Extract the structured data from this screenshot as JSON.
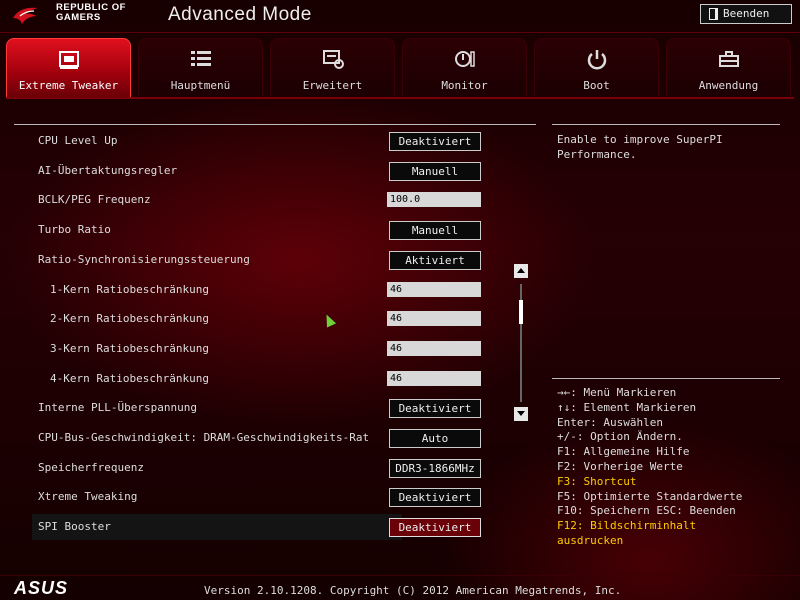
{
  "header": {
    "brand_line1": "REPUBLIC OF",
    "brand_line2": "GAMERS",
    "mode_title": "Advanced Mode",
    "exit_label": "Beenden"
  },
  "tabs": [
    {
      "label": "Extreme Tweaker",
      "icon": "tweaker-icon",
      "active": true
    },
    {
      "label": "Hauptmenü",
      "icon": "list-icon",
      "active": false
    },
    {
      "label": "Erweitert",
      "icon": "advanced-icon",
      "active": false
    },
    {
      "label": "Monitor",
      "icon": "monitor-icon",
      "active": false
    },
    {
      "label": "Boot",
      "icon": "power-icon",
      "active": false
    },
    {
      "label": "Anwendung",
      "icon": "toolbox-icon",
      "active": false
    }
  ],
  "settings": [
    {
      "label": "CPU Level Up",
      "value": "Deaktiviert",
      "type": "button"
    },
    {
      "label": "AI-Übertaktungsregler",
      "value": "Manuell",
      "type": "button"
    },
    {
      "label": "BCLK/PEG Frequenz",
      "value": "100.0",
      "type": "input"
    },
    {
      "label": "Turbo Ratio",
      "value": "Manuell",
      "type": "button"
    },
    {
      "label": "Ratio-Synchronisierungssteuerung",
      "value": "Aktiviert",
      "type": "button"
    },
    {
      "label": "1-Kern Ratiobeschränkung",
      "value": "46",
      "type": "input"
    },
    {
      "label": "2-Kern Ratiobeschränkung",
      "value": "46",
      "type": "input"
    },
    {
      "label": "3-Kern Ratiobeschränkung",
      "value": "46",
      "type": "input"
    },
    {
      "label": "4-Kern Ratiobeschränkung",
      "value": "46",
      "type": "input"
    },
    {
      "label": "Interne PLL-Überspannung",
      "value": "Deaktiviert",
      "type": "button"
    },
    {
      "label": "CPU-Bus-Geschwindigkeit: DRAM-Geschwindigkeits-Rat",
      "value": "Auto",
      "type": "button"
    },
    {
      "label": "Speicherfrequenz",
      "value": "DDR3-1866MHz",
      "type": "button"
    },
    {
      "label": "Xtreme Tweaking",
      "value": "Deaktiviert",
      "type": "button"
    },
    {
      "label": "SPI Booster",
      "value": "Deaktiviert",
      "type": "button"
    }
  ],
  "help": {
    "text": "Enable to improve SuperPI Performance."
  },
  "keys": [
    {
      "text": "→←: Menü Markieren",
      "highlight": false
    },
    {
      "text": "↑↓: Element Markieren",
      "highlight": false
    },
    {
      "text": "Enter: Auswählen",
      "highlight": false
    },
    {
      "text": "+/-: Option Ändern.",
      "highlight": false
    },
    {
      "text": "F1: Allgemeine Hilfe",
      "highlight": false
    },
    {
      "text": "F2: Vorherige Werte",
      "highlight": false
    },
    {
      "text": "F3: Shortcut",
      "highlight": true
    },
    {
      "text": "F5: Optimierte Standardwerte",
      "highlight": false
    },
    {
      "text": "F10: Speichern  ESC: Beenden",
      "highlight": false
    },
    {
      "text": "F12: Bildschirminhalt",
      "highlight": true
    },
    {
      "text": "ausdrucken",
      "highlight": true
    }
  ],
  "footer": {
    "brand": "ASUS",
    "version": "Version 2.10.1208. Copyright (C) 2012 American Megatrends, Inc."
  },
  "colors": {
    "accent": "#c8101e",
    "highlight_text": "#ffcc00"
  }
}
